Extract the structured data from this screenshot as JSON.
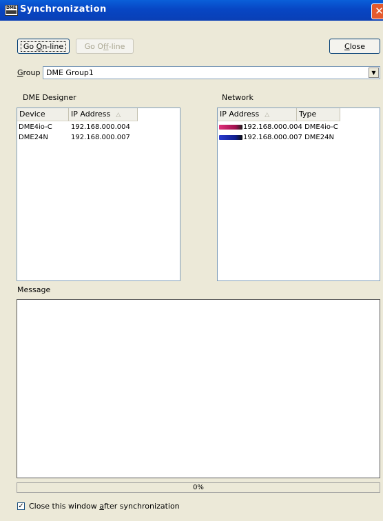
{
  "window": {
    "title": "Synchronization",
    "app_icon": "DME"
  },
  "toolbar": {
    "online_pre": "Go ",
    "online_u": "O",
    "online_post": "n-line",
    "offline_pre": "Go O",
    "offline_u": "f",
    "offline_post": "f-line",
    "close_u": "C",
    "close_post": "lose"
  },
  "group": {
    "label_u": "G",
    "label_post": "roup",
    "value": "DME Group1"
  },
  "designer": {
    "title": "DME Designer",
    "columns": [
      "Device",
      "IP Address"
    ],
    "rows": [
      {
        "device": "DME4io-C",
        "ip": "192.168.000.004"
      },
      {
        "device": "DME24N",
        "ip": "192.168.000.007"
      }
    ]
  },
  "network": {
    "title": "Network",
    "columns": [
      "IP Address",
      "Type"
    ],
    "rows": [
      {
        "ip": "192.168.000.004",
        "type": "DME4io-C",
        "icon": "dme4io-device-icon",
        "color": "#c81e6e"
      },
      {
        "ip": "192.168.000.007",
        "type": "DME24N",
        "icon": "dme24n-device-icon",
        "color": "#1f2fae"
      }
    ]
  },
  "message": {
    "label": "Message"
  },
  "progress": {
    "text": "0%",
    "value": 0
  },
  "footer": {
    "checkbox_pre": "Close this window ",
    "checkbox_u": "a",
    "checkbox_post": "fter synchronization",
    "checked": true
  }
}
